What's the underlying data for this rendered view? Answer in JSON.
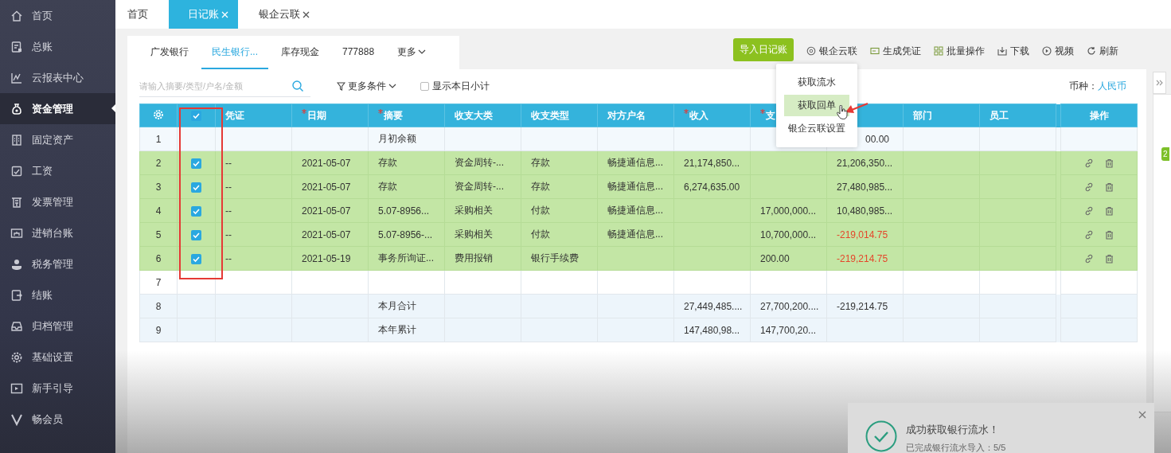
{
  "sidebar": {
    "items": [
      {
        "label": "首页",
        "selected": false
      },
      {
        "label": "总账",
        "selected": false
      },
      {
        "label": "云报表中心",
        "selected": false
      },
      {
        "label": "资金管理",
        "selected": true
      },
      {
        "label": "固定资产",
        "selected": false
      },
      {
        "label": "工资",
        "selected": false
      },
      {
        "label": "发票管理",
        "selected": false
      },
      {
        "label": "进销台账",
        "selected": false
      },
      {
        "label": "税务管理",
        "selected": false
      },
      {
        "label": "结账",
        "selected": false
      },
      {
        "label": "归档管理",
        "selected": false
      },
      {
        "label": "基础设置",
        "selected": false
      },
      {
        "label": "新手引导",
        "selected": false
      },
      {
        "label": "畅会员",
        "selected": false
      }
    ]
  },
  "tabs": [
    {
      "label": "首页",
      "selected": false,
      "closable": false
    },
    {
      "label": "日记账",
      "selected": true,
      "closable": true
    },
    {
      "label": "银企云联",
      "selected": false,
      "closable": true
    }
  ],
  "accounts": [
    {
      "label": "广发银行",
      "selected": false,
      "kind": "tab"
    },
    {
      "label": "民生银行...",
      "selected": true,
      "kind": "tab"
    },
    {
      "label": "库存现金",
      "selected": false,
      "kind": "tab"
    },
    {
      "label": "777888",
      "selected": false,
      "kind": "tab"
    },
    {
      "label": "更多",
      "selected": false,
      "kind": "menu"
    }
  ],
  "toolbar": {
    "primary": "导入日记账",
    "actions": [
      "银企云联",
      "生成凭证",
      "批量操作",
      "下载",
      "视频",
      "刷新"
    ]
  },
  "dropdown": {
    "items": [
      {
        "label": "获取流水",
        "selected": false
      },
      {
        "label": "获取回单",
        "selected": true
      },
      {
        "label": "银企云联设置",
        "selected": false
      }
    ]
  },
  "filters": {
    "placeholder": "请输入摘要/类型/户名/金额",
    "more": "更多条件",
    "daily_subtotal": {
      "label": "显示本日小计",
      "checked": false
    },
    "currency_label": "币种：",
    "currency": "人民币"
  },
  "table": {
    "header_checked": true,
    "columns": [
      {
        "label": "凭证",
        "required": false
      },
      {
        "label": "日期",
        "required": true
      },
      {
        "label": "摘要",
        "required": true
      },
      {
        "label": "收支大类",
        "required": false
      },
      {
        "label": "收支类型",
        "required": false
      },
      {
        "label": "对方户名",
        "required": false
      },
      {
        "label": "收入",
        "required": true
      },
      {
        "label": "支",
        "required": true
      },
      {},
      {
        "label": "部门",
        "required": false
      },
      {
        "label": "员工",
        "required": false
      }
    ],
    "actions_label": "操作",
    "rows": [
      {
        "no": "1",
        "kind": "opening",
        "selected": false,
        "summary": "月初余额",
        "balance": "00.00",
        "balance_alert": false
      },
      {
        "no": "2",
        "kind": "entry",
        "selected": true,
        "voucher": "--",
        "date": "2021-05-07",
        "summary": "存款",
        "category": "资金周转-...",
        "type": "存款",
        "counterparty": "畅捷通信息...",
        "income": "21,174,850...",
        "balance": "21,206,350...",
        "balance_alert": false
      },
      {
        "no": "3",
        "kind": "entry",
        "selected": true,
        "voucher": "--",
        "date": "2021-05-07",
        "summary": "存款",
        "category": "资金周转-...",
        "type": "存款",
        "counterparty": "畅捷通信息...",
        "income": "6,274,635.00",
        "balance": "27,480,985...",
        "balance_alert": false
      },
      {
        "no": "4",
        "kind": "entry",
        "selected": true,
        "voucher": "--",
        "date": "2021-05-07",
        "summary": "5.07-8956...",
        "category": "采购相关",
        "type": "付款",
        "counterparty": "畅捷通信息...",
        "expense": "17,000,000...",
        "balance": "10,480,985...",
        "balance_alert": false
      },
      {
        "no": "5",
        "kind": "entry",
        "selected": true,
        "voucher": "--",
        "date": "2021-05-07",
        "summary": "5.07-8956-...",
        "category": "采购相关",
        "type": "付款",
        "counterparty": "畅捷通信息...",
        "expense": "10,700,000...",
        "balance": "-219,014.75",
        "balance_alert": true
      },
      {
        "no": "6",
        "kind": "entry",
        "selected": true,
        "voucher": "--",
        "date": "2021-05-19",
        "summary": "事务所询证...",
        "category": "费用报销",
        "type": "银行手续费",
        "expense": "200.00",
        "balance": "-219,214.75",
        "balance_alert": true
      },
      {
        "no": "7",
        "kind": "blank",
        "selected": false
      },
      {
        "no": "8",
        "kind": "total",
        "selected": false,
        "summary": "本月合计",
        "income": "27,449,485....",
        "expense": "27,700,200....",
        "balance": "-219,214.75",
        "balance_alert": false
      },
      {
        "no": "9",
        "kind": "total",
        "selected": false,
        "summary": "本年累计",
        "income": "147,480,98...",
        "expense": "147,700,20..."
      }
    ]
  },
  "toast": {
    "title": "成功获取银行流水！",
    "message": "已完成银行流水导入：5/5"
  },
  "side_badge": "2"
}
